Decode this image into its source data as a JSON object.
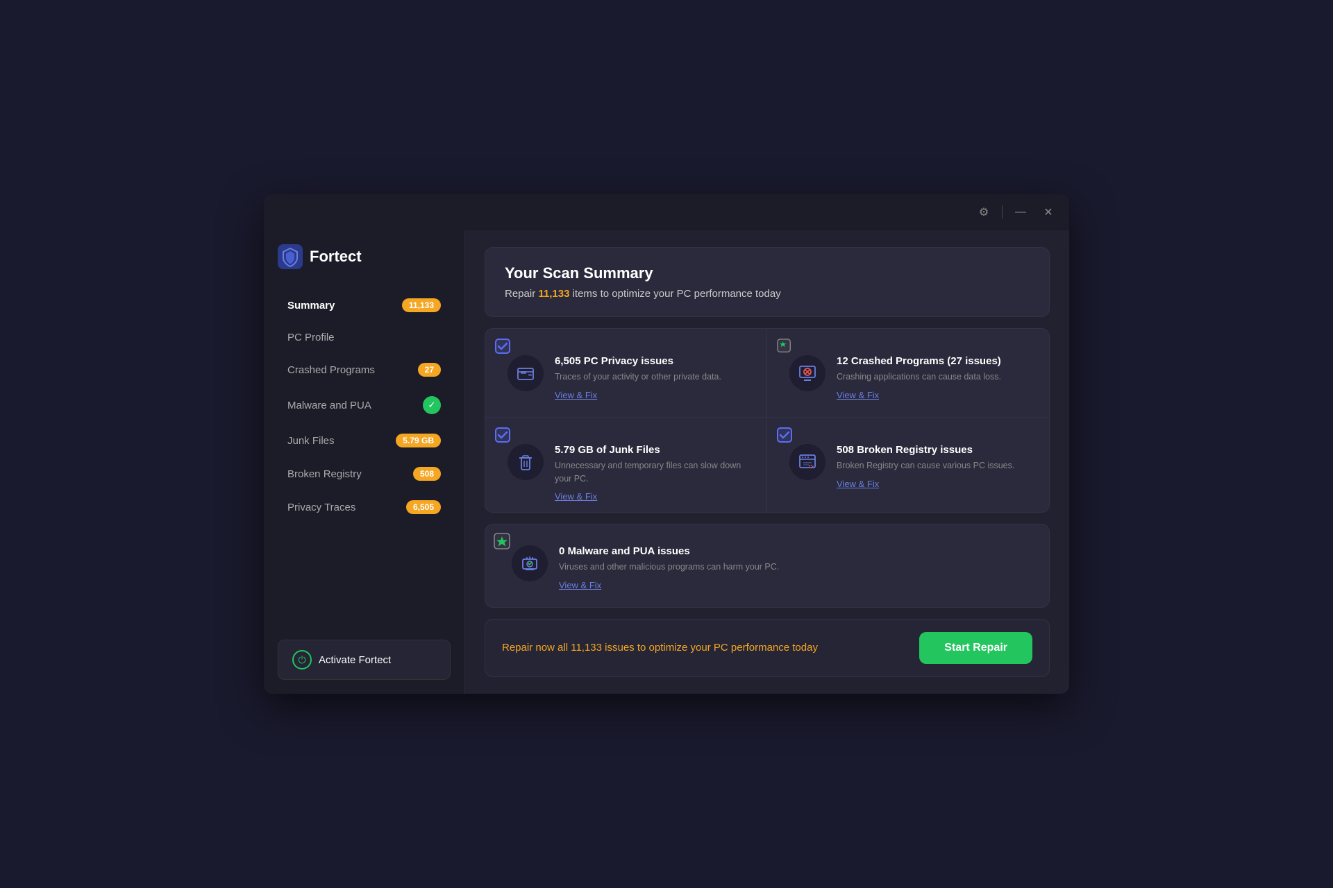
{
  "app": {
    "title": "Fortect",
    "logo_text": "Fortect"
  },
  "titlebar": {
    "settings_icon": "⚙",
    "minimize_icon": "—",
    "close_icon": "✕"
  },
  "sidebar": {
    "items": [
      {
        "id": "summary",
        "label": "Summary",
        "badge": "11,133",
        "badge_type": "orange",
        "active": true
      },
      {
        "id": "pc-profile",
        "label": "PC Profile",
        "badge": null,
        "badge_type": null
      },
      {
        "id": "crashed-programs",
        "label": "Crashed Programs",
        "badge": "27",
        "badge_type": "orange"
      },
      {
        "id": "malware-pua",
        "label": "Malware and PUA",
        "badge": "check",
        "badge_type": "green"
      },
      {
        "id": "junk-files",
        "label": "Junk Files",
        "badge": "5.79 GB",
        "badge_type": "orange"
      },
      {
        "id": "broken-registry",
        "label": "Broken Registry",
        "badge": "508",
        "badge_type": "orange"
      },
      {
        "id": "privacy-traces",
        "label": "Privacy Traces",
        "badge": "6,505",
        "badge_type": "orange"
      }
    ],
    "activate_btn": "Activate Fortect"
  },
  "scan_summary": {
    "title": "Your Scan Summary",
    "description_prefix": "Repair ",
    "highlight": "11,133",
    "description_suffix": " items to optimize your PC performance today"
  },
  "issues": [
    {
      "id": "privacy",
      "title": "6,505 PC Privacy issues",
      "description": "Traces of your activity or other private data.",
      "view_fix": "View & Fix",
      "icon_type": "privacy",
      "badge_type": "checkbox"
    },
    {
      "id": "crashed",
      "title": "12 Crashed Programs (27 issues)",
      "description": "Crashing applications can cause data loss.",
      "view_fix": "View & Fix",
      "icon_type": "crashed",
      "badge_type": "star"
    },
    {
      "id": "junk",
      "title": "5.79 GB of Junk Files",
      "description": "Unnecessary and temporary files can slow down your PC.",
      "view_fix": "View & Fix",
      "icon_type": "junk",
      "badge_type": "checkbox"
    },
    {
      "id": "registry",
      "title": "508 Broken Registry issues",
      "description": "Broken Registry can cause various PC issues.",
      "view_fix": "View & Fix",
      "icon_type": "registry",
      "badge_type": "checkbox"
    }
  ],
  "malware_issue": {
    "title": "0 Malware and PUA issues",
    "description": "Viruses and other malicious programs can harm your PC.",
    "view_fix": "View & Fix",
    "icon_type": "malware",
    "badge_type": "star"
  },
  "bottom_bar": {
    "text": "Repair now all 11,133 issues to optimize your PC performance today",
    "button_label": "Start Repair"
  }
}
